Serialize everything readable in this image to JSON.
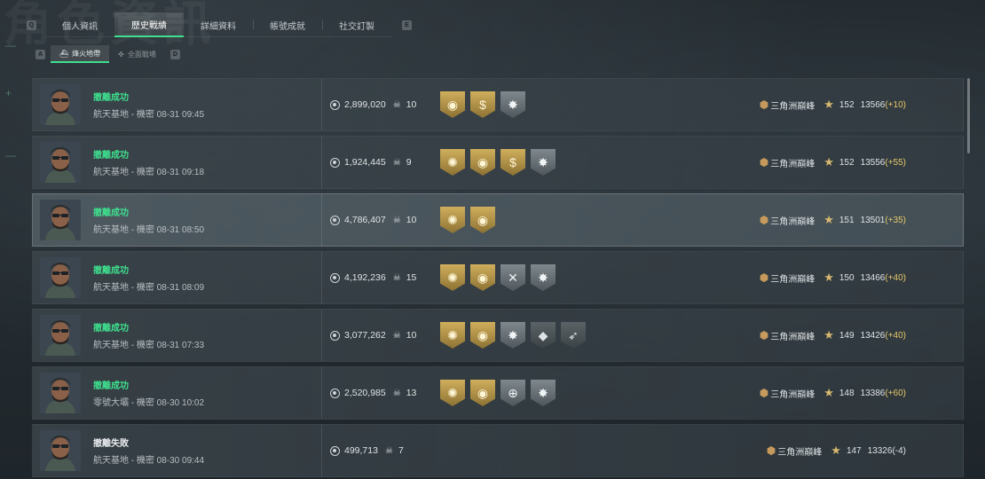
{
  "background_title": "角色資訊",
  "keys": {
    "prev_tab": "Q",
    "next_tab": "E",
    "prev_mode": "A",
    "next_mode": "D"
  },
  "tabs": [
    {
      "label": "個人資訊",
      "active": false
    },
    {
      "label": "歷史戰績",
      "active": true
    },
    {
      "label": "詳細資料",
      "active": false
    },
    {
      "label": "帳號成就",
      "active": false
    },
    {
      "label": "社交訂製",
      "active": false
    }
  ],
  "modes": [
    {
      "label": "烽火地帶",
      "icon": "ship-icon",
      "active": true
    },
    {
      "label": "全面戰場",
      "icon": "crosshair-icon",
      "active": false
    }
  ],
  "colors": {
    "accent": "#3ee08e",
    "gold_badge": "#cfae5c",
    "silver_badge": "#7f888d",
    "delta": "#e6c76a"
  },
  "records": [
    {
      "status": "撤離成功",
      "success": true,
      "location": "航天基地 - 機密 08-31 09:45",
      "value": "2,899,020",
      "kills": "10",
      "badges": [
        {
          "tier": "gold",
          "icon": "shield-emblem-icon"
        },
        {
          "tier": "gold",
          "icon": "dollar-emblem-icon"
        },
        {
          "tier": "silver",
          "icon": "star-burst-icon"
        }
      ],
      "rank": "三角洲巔峰",
      "level": "152",
      "score": "13566",
      "delta": "(+10)"
    },
    {
      "status": "撤離成功",
      "success": true,
      "location": "航天基地 - 機密 08-31 09:18",
      "value": "1,924,445",
      "kills": "9",
      "badges": [
        {
          "tier": "gold",
          "icon": "sunburst-icon"
        },
        {
          "tier": "gold",
          "icon": "shield-emblem-icon"
        },
        {
          "tier": "gold",
          "icon": "dollar-emblem-icon"
        },
        {
          "tier": "silver",
          "icon": "star-burst-icon"
        }
      ],
      "rank": "三角洲巔峰",
      "level": "152",
      "score": "13556",
      "delta": "(+55)"
    },
    {
      "status": "撤離成功",
      "success": true,
      "location": "航天基地 - 機密 08-31 08:50",
      "value": "4,786,407",
      "kills": "10",
      "badges": [
        {
          "tier": "gold",
          "icon": "sunburst-icon"
        },
        {
          "tier": "gold",
          "icon": "shield-emblem-icon"
        }
      ],
      "rank": "三角洲巔峰",
      "level": "151",
      "score": "13501",
      "delta": "(+35)",
      "highlight": true
    },
    {
      "status": "撤離成功",
      "success": true,
      "location": "航天基地 - 機密 08-31 08:09",
      "value": "4,192,236",
      "kills": "15",
      "badges": [
        {
          "tier": "gold",
          "icon": "sunburst-icon"
        },
        {
          "tier": "gold",
          "icon": "shield-emblem-icon"
        },
        {
          "tier": "silver",
          "icon": "crossed-tools-icon"
        },
        {
          "tier": "silver",
          "icon": "star-burst-icon"
        }
      ],
      "rank": "三角洲巔峰",
      "level": "150",
      "score": "13466",
      "delta": "(+40)"
    },
    {
      "status": "撤離成功",
      "success": true,
      "location": "航天基地 - 機密 08-31 07:33",
      "value": "3,077,262",
      "kills": "10",
      "badges": [
        {
          "tier": "gold",
          "icon": "sunburst-icon"
        },
        {
          "tier": "gold",
          "icon": "shield-emblem-icon"
        },
        {
          "tier": "silver",
          "icon": "star-burst-icon"
        },
        {
          "tier": "dark",
          "icon": "diamond-icon"
        },
        {
          "tier": "dark",
          "icon": "gun-icon"
        }
      ],
      "rank": "三角洲巔峰",
      "level": "149",
      "score": "13426",
      "delta": "(+40)"
    },
    {
      "status": "撤離成功",
      "success": true,
      "location": "零號大壩 - 機密 08-30 10:02",
      "value": "2,520,985",
      "kills": "13",
      "badges": [
        {
          "tier": "gold",
          "icon": "sunburst-icon"
        },
        {
          "tier": "gold",
          "icon": "shield-emblem-icon"
        },
        {
          "tier": "silver",
          "icon": "crosshair-emblem-icon"
        },
        {
          "tier": "silver",
          "icon": "star-burst-icon"
        }
      ],
      "rank": "三角洲巔峰",
      "level": "148",
      "score": "13386",
      "delta": "(+60)"
    },
    {
      "status": "撤離失敗",
      "success": false,
      "location": "航天基地 - 機密 08-30 09:44",
      "value": "499,713",
      "kills": "7",
      "badges": [],
      "rank": "三角洲巔峰",
      "level": "147",
      "score": "13326",
      "delta": "(-4)"
    }
  ]
}
